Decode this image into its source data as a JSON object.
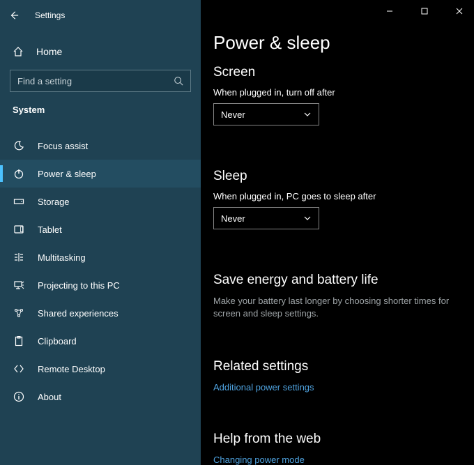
{
  "window": {
    "title": "Settings"
  },
  "sidebar": {
    "home_label": "Home",
    "search_placeholder": "Find a setting",
    "category": "System",
    "items": [
      {
        "label": "Focus assist"
      },
      {
        "label": "Power & sleep"
      },
      {
        "label": "Storage"
      },
      {
        "label": "Tablet"
      },
      {
        "label": "Multitasking"
      },
      {
        "label": "Projecting to this PC"
      },
      {
        "label": "Shared experiences"
      },
      {
        "label": "Clipboard"
      },
      {
        "label": "Remote Desktop"
      },
      {
        "label": "About"
      }
    ]
  },
  "main": {
    "title": "Power & sleep",
    "screen": {
      "heading": "Screen",
      "label": "When plugged in, turn off after",
      "value": "Never"
    },
    "sleep": {
      "heading": "Sleep",
      "label": "When plugged in, PC goes to sleep after",
      "value": "Never"
    },
    "save_energy": {
      "heading": "Save energy and battery life",
      "desc": "Make your battery last longer by choosing shorter times for screen and sleep settings."
    },
    "related": {
      "heading": "Related settings",
      "link": "Additional power settings"
    },
    "help": {
      "heading": "Help from the web",
      "link": "Changing power mode"
    }
  }
}
